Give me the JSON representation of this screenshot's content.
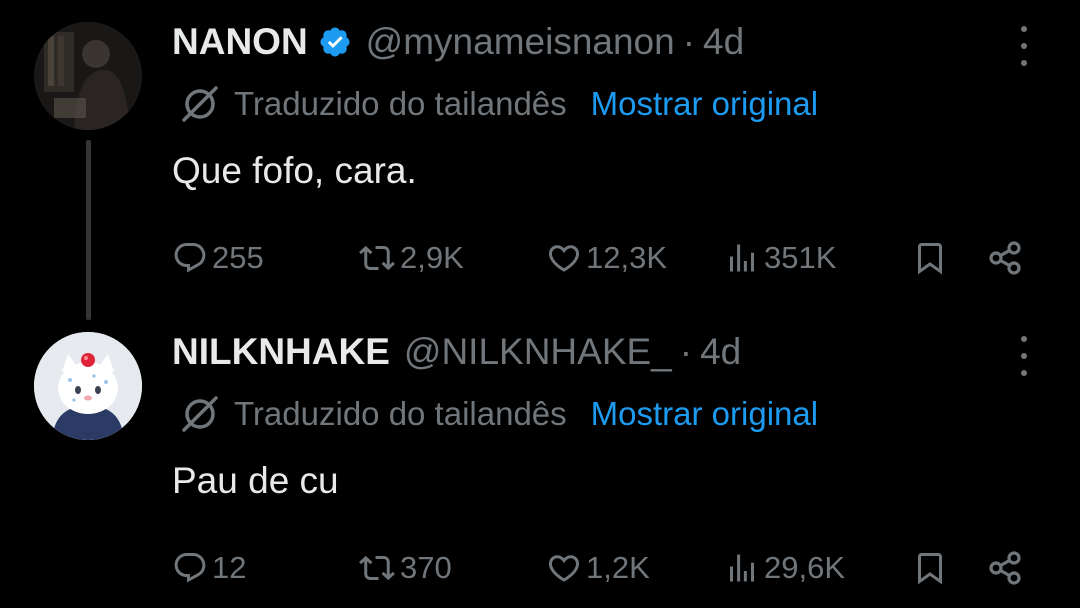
{
  "tweets": [
    {
      "display_name": "NANON",
      "verified": true,
      "handle": "@mynameisnanon",
      "time": "4d",
      "translated_from": "Traduzido do tailandês",
      "show_original": "Mostrar original",
      "text": "Que fofo, cara.",
      "replies": "255",
      "retweets": "2,9K",
      "likes": "12,3K",
      "views": "351K"
    },
    {
      "display_name": "NILKNHAKE",
      "verified": false,
      "handle": "@NILKNHAKE_",
      "time": "4d",
      "translated_from": "Traduzido do tailandês",
      "show_original": "Mostrar original",
      "text": "Pau de cu",
      "replies": "12",
      "retweets": "370",
      "likes": "1,2K",
      "views": "29,6K"
    }
  ],
  "separator": "·",
  "colors": {
    "background": "#000000",
    "text": "#e7e9ea",
    "muted": "#71767b",
    "accent": "#1d9bf0",
    "thread_line": "#333639"
  },
  "icons": [
    "more-icon",
    "globe-translate-icon",
    "verified-badge-icon",
    "reply-icon",
    "retweet-icon",
    "like-icon",
    "views-icon",
    "bookmark-icon",
    "share-icon"
  ]
}
